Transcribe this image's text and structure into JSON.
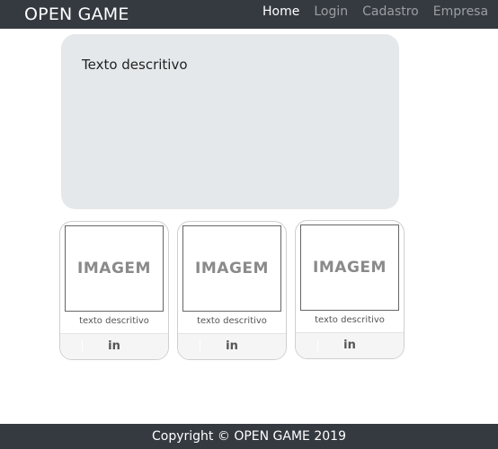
{
  "navbar": {
    "brand": "OPEN GAME",
    "links": [
      {
        "label": "Home",
        "active": true
      },
      {
        "label": "Login",
        "active": false
      },
      {
        "label": "Cadastro",
        "active": false
      },
      {
        "label": "Empresa",
        "active": false
      }
    ]
  },
  "hero": {
    "text": "Texto descritivo"
  },
  "cards": [
    {
      "image_text": "IMAGEM",
      "caption": "texto descritivo",
      "social": "in"
    },
    {
      "image_text": "IMAGEM",
      "caption": "texto descritivo",
      "social": "in"
    },
    {
      "image_text": "IMAGEM",
      "caption": "texto descritivo",
      "social": "in"
    }
  ],
  "footer": {
    "copyright": "Copyright © OPEN GAME 2019"
  },
  "colors": {
    "navbar_bg": "#343a40",
    "hero_bg": "#e5e8eb",
    "nav_active": "#ffffff",
    "nav_inactive": "rgba(255,255,255,0.5)"
  }
}
